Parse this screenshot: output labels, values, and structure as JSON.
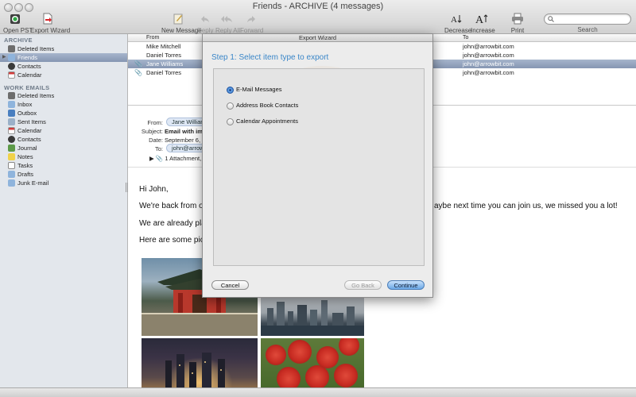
{
  "window": {
    "title": "Friends - ARCHIVE (4 messages)"
  },
  "toolbar": {
    "open_pst": "Open PST",
    "export_wizard": "Export Wizard",
    "new_message": "New Message",
    "reply": "Reply",
    "reply_all": "Reply All",
    "forward": "Forward",
    "decrease": "Decrease",
    "increase": "Increase",
    "print": "Print",
    "search_label": "Search",
    "search_placeholder": ""
  },
  "sidebar": {
    "archive_label": "ARCHIVE",
    "archive_items": [
      {
        "label": "Deleted Items",
        "icon": "trash-icon"
      },
      {
        "label": "Friends",
        "icon": "folder-icon",
        "selected": true
      },
      {
        "label": "Contacts",
        "icon": "contacts-icon"
      },
      {
        "label": "Calendar",
        "icon": "calendar-icon"
      }
    ],
    "work_label": "WORK EMAILS",
    "work_items": [
      {
        "label": "Deleted Items",
        "icon": "trash-icon"
      },
      {
        "label": "Inbox",
        "icon": "inbox-icon"
      },
      {
        "label": "Outbox",
        "icon": "outbox-icon"
      },
      {
        "label": "Sent Items",
        "icon": "sent-icon"
      },
      {
        "label": "Calendar",
        "icon": "calendar-icon"
      },
      {
        "label": "Contacts",
        "icon": "contacts-icon"
      },
      {
        "label": "Journal",
        "icon": "journal-icon"
      },
      {
        "label": "Notes",
        "icon": "notes-icon"
      },
      {
        "label": "Tasks",
        "icon": "tasks-icon"
      },
      {
        "label": "Drafts",
        "icon": "drafts-icon"
      },
      {
        "label": "Junk E-mail",
        "icon": "junk-icon"
      }
    ]
  },
  "message_list": {
    "col_from": "From",
    "col_to": "To",
    "rows": [
      {
        "from": "Mike Mitchell",
        "to": "john@arrowbit.com",
        "attachment": false,
        "selected": false
      },
      {
        "from": "Daniel Torres",
        "to": "john@arrowbit.com",
        "attachment": false,
        "selected": false
      },
      {
        "from": "Jane Williams",
        "to": "john@arrowbit.com",
        "attachment": true,
        "selected": true
      },
      {
        "from": "Daniel Torres",
        "to": "john@arrowbit.com",
        "attachment": true,
        "selected": false
      }
    ]
  },
  "preview": {
    "from_label": "From:",
    "from_value": "Jane Willian",
    "subject_label": "Subject:",
    "subject_value": "Email with imag",
    "date_label": "Date:",
    "date_value": "September 6, 20",
    "to_label": "To:",
    "to_value": "john@arrow",
    "attachment_summary": "1 Attachment, 6",
    "body": {
      "greeting": "Hi John,",
      "line1_left": "We're back from ou",
      "line1_right": "aybe next time you can join us, we missed you a lot!",
      "line2": "We are already pla",
      "line3": "Here are some pict"
    }
  },
  "dialog": {
    "title": "Export Wizard",
    "heading": "Step 1: Select item type to export",
    "options": [
      {
        "label": "E-Mail Messages",
        "checked": true
      },
      {
        "label": "Address Book Contacts",
        "checked": false
      },
      {
        "label": "Calendar Appointments",
        "checked": false
      }
    ],
    "cancel": "Cancel",
    "go_back": "Go Back",
    "continue": "Continue"
  }
}
